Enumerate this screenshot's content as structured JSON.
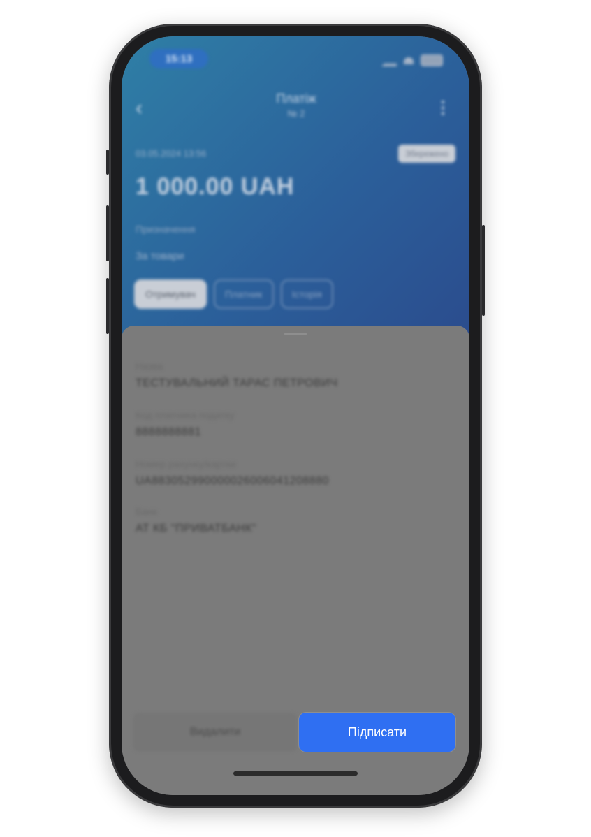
{
  "status_bar": {
    "time": "15:13"
  },
  "header": {
    "back_icon": "chevron-left-icon",
    "title": "Платіж",
    "subtitle": "№ 2",
    "menu_icon": "more-vertical-icon",
    "date": "03.05.2024 13:56",
    "status_badge": "Збережено",
    "amount": "1 000.00 UAH",
    "purpose_label": "Призначення",
    "purpose_value": "За товари"
  },
  "tabs": [
    {
      "label": "Отримувач",
      "active": true
    },
    {
      "label": "Платник",
      "active": false
    },
    {
      "label": "Історія",
      "active": false
    }
  ],
  "recipient": {
    "name_label": "Назва",
    "name_value": "ТЕСТУВАЛЬНИЙ ТАРАС ПЕТРОВИЧ",
    "tax_label": "Код платника податку",
    "tax_value": "8888888881",
    "account_label": "Номер рахунку/картки",
    "account_value": "UA883052990000026006041208880",
    "bank_label": "Банк",
    "bank_value": "АТ КБ \"ПРИВАТБАНК\""
  },
  "actions": {
    "delete_label": "Видалити",
    "sign_label": "Підписати"
  },
  "colors": {
    "accent": "#2f6ff2",
    "header_gradient_start": "#2f7fa6",
    "header_gradient_end": "#2b4a8c",
    "overlay": "#7b7b7b"
  }
}
